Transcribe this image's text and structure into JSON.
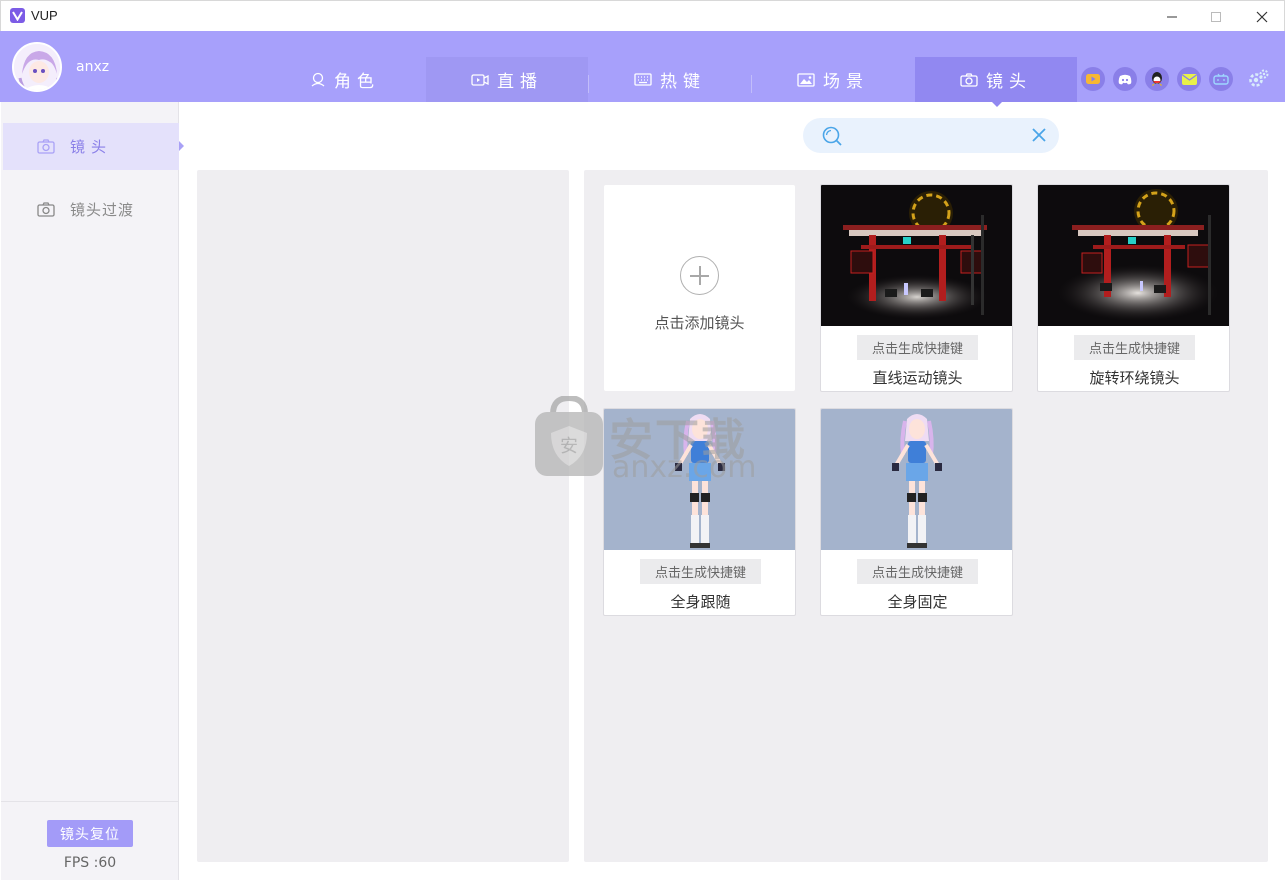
{
  "window": {
    "title": "VUP",
    "controls": [
      "minimize-icon",
      "maximize-icon",
      "close-icon"
    ]
  },
  "user": {
    "name": "anxz"
  },
  "nav": {
    "tabs": [
      {
        "label": "角色",
        "icon": "user-icon"
      },
      {
        "label": "直播",
        "icon": "video-icon"
      },
      {
        "label": "热键",
        "icon": "keyboard-icon"
      },
      {
        "label": "场景",
        "icon": "image-icon"
      },
      {
        "label": "镜头",
        "icon": "camera-icon",
        "active": true
      }
    ],
    "social_icons": [
      "youtube-icon",
      "discord-icon",
      "qq-icon",
      "mail-icon",
      "bilibili-icon"
    ],
    "settings_icon": "gear-icon"
  },
  "sidebar": {
    "items": [
      {
        "label": "镜头",
        "icon": "camera-icon",
        "active": true
      },
      {
        "label": "镜头过渡",
        "icon": "camera-icon"
      }
    ],
    "reset_label": "镜头复位",
    "fps": "FPS :60"
  },
  "search": {
    "value": "",
    "placeholder": ""
  },
  "cards": {
    "add_label": "点击添加镜头",
    "generate_label": "点击生成快捷键",
    "items": [
      {
        "title": "直线运动镜头",
        "thumb": "stage"
      },
      {
        "title": "旋转环绕镜头",
        "thumb": "stage"
      },
      {
        "title": "全身跟随",
        "thumb": "character"
      },
      {
        "title": "全身固定",
        "thumb": "character"
      }
    ]
  },
  "watermark": {
    "text": "安下载",
    "sub": "anxz.com"
  },
  "colors": {
    "header": "#a7a0fb",
    "accent": "#9188f1",
    "sidebar_active": "#e4e1fb",
    "panel": "#efeef1",
    "search_bg": "#e9f2fd"
  }
}
